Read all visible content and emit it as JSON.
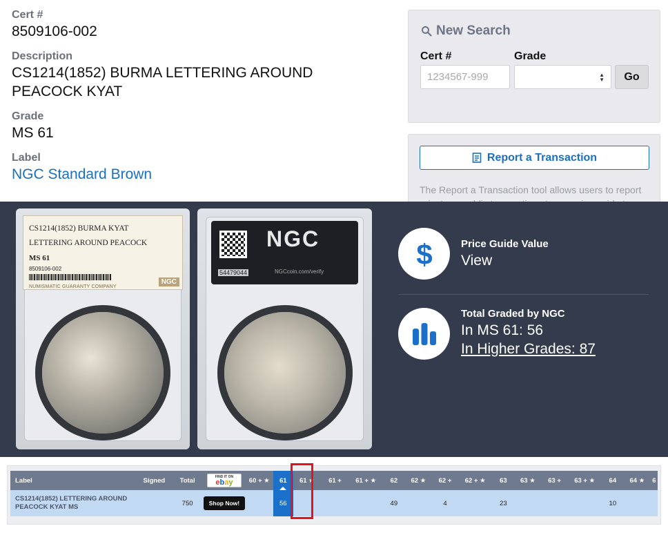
{
  "cert": {
    "cert_label": "Cert #",
    "cert_value": "8509106-002",
    "description_label": "Description",
    "description_value": "CS1214(1852) BURMA LETTERING AROUND PEACOCK KYAT",
    "grade_label": "Grade",
    "grade_value": "MS 61",
    "label_label": "Label",
    "label_value": "NGC Standard Brown"
  },
  "search": {
    "title": "New Search",
    "cert_label": "Cert #",
    "cert_placeholder": "1234567-999",
    "grade_label": "Grade",
    "grade_selected": "",
    "go_label": "Go"
  },
  "report": {
    "button_label": "Report a Transaction",
    "text": "The Report a Transaction tool allows users to report private or public transactions to our price guide team."
  },
  "slab_front": {
    "line1": "CS1214(1852) BURMA KYAT",
    "line2": "LETTERING AROUND PEACOCK",
    "grade": "MS 61",
    "cert": "8509106-002",
    "company": "NUMISMATIC GUARANTY COMPANY",
    "logo": "NGC"
  },
  "slab_back": {
    "logo": "NGC",
    "number": "54479044",
    "url": "NGCcoin.com/verify"
  },
  "stats": {
    "price_title": "Price Guide Value",
    "price_value": "View",
    "total_title": "Total Graded by NGC",
    "in_grade": "In MS 61: 56",
    "higher": "In Higher Grades: 87",
    "price_icon": "dollar-icon",
    "total_icon": "bar-chart-icon"
  },
  "population": {
    "headers": [
      "Label",
      "Signed",
      "Total",
      "",
      "60 + ★",
      "61",
      "61 ★",
      "61 +",
      "61 + ★",
      "62",
      "62 ★",
      "62 +",
      "62 + ★",
      "63",
      "63 ★",
      "63 +",
      "63 + ★",
      "64",
      "64 ★",
      "6"
    ],
    "ebay_small": "FIND IT ON",
    "ebay_brand": [
      "e",
      "b",
      "a",
      "y"
    ],
    "row": {
      "label": "CS1214(1852) LETTERING AROUND PEACOCK KYAT MS",
      "signed": "",
      "total": "750",
      "shop": "Shop Now!",
      "cells": [
        "",
        "56",
        "",
        "",
        "",
        "49",
        "",
        "4",
        "",
        "23",
        "",
        "",
        "",
        "10",
        "",
        ""
      ]
    }
  },
  "colors": {
    "accent": "#1a6fc4",
    "band": "#343b4d",
    "highlight": "#1b70c9",
    "marker": "#e2141c"
  }
}
